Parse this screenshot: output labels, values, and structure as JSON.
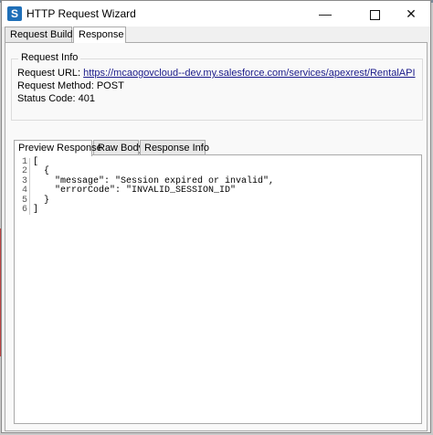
{
  "window": {
    "title": "HTTP Request Wizard",
    "min_icon": "minimize-icon",
    "max_icon": "maximize-icon",
    "close_icon": "close-icon"
  },
  "tabs": [
    {
      "label": "Request Builder",
      "active": false
    },
    {
      "label": "Response",
      "active": true
    }
  ],
  "request_info": {
    "legend": "Request Info",
    "url_label": "Request URL:",
    "url_value": "https://mcaogovcloud--dev.my.salesforce.com/services/apexrest/RentalAPI",
    "method_label": "Request Method:",
    "method_value": "POST",
    "status_label": "Status Code:",
    "status_value": "401"
  },
  "response_tabs": [
    {
      "label": "Preview Response",
      "active": true
    },
    {
      "label": "Raw Body",
      "active": false
    },
    {
      "label": "Response Info",
      "active": false
    }
  ],
  "code_lines": [
    {
      "n": "1",
      "text": "["
    },
    {
      "n": "2",
      "text": "  {"
    },
    {
      "n": "3",
      "text": "    \"message\": \"Session expired or invalid\","
    },
    {
      "n": "4",
      "text": "    \"errorCode\": \"INVALID_SESSION_ID\""
    },
    {
      "n": "5",
      "text": "  }"
    },
    {
      "n": "6",
      "text": "]"
    }
  ],
  "colors": {
    "app_icon": "#1f6fb8",
    "link": "#1a1a8a"
  }
}
